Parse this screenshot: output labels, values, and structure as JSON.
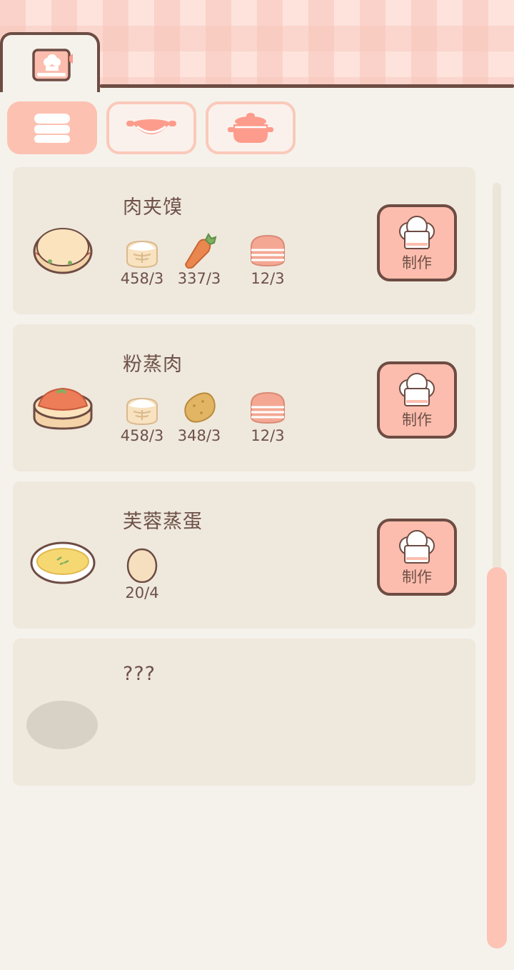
{
  "tabs": {
    "book_tab_icon": "chef-recipe-book-icon",
    "categories": [
      {
        "icon": "steamer-icon",
        "active": true
      },
      {
        "icon": "wok-icon",
        "active": false
      },
      {
        "icon": "pot-icon",
        "active": false
      }
    ]
  },
  "recipes": [
    {
      "name": "肉夹馍",
      "dish_icon": "roujiamo-icon",
      "ingredients": [
        {
          "icon": "flour-icon",
          "count": "458/3"
        },
        {
          "icon": "carrot-icon",
          "count": "337/3"
        },
        {
          "icon": "bacon-icon",
          "count": "12/3"
        }
      ],
      "make_label": "制作"
    },
    {
      "name": "粉蒸肉",
      "dish_icon": "steamed-pork-icon",
      "ingredients": [
        {
          "icon": "flour-icon",
          "count": "458/3"
        },
        {
          "icon": "potato-icon",
          "count": "348/3"
        },
        {
          "icon": "bacon-icon",
          "count": "12/3"
        }
      ],
      "make_label": "制作"
    },
    {
      "name": "芙蓉蒸蛋",
      "dish_icon": "steamed-egg-icon",
      "ingredients": [
        {
          "icon": "egg-icon",
          "count": "20/4"
        }
      ],
      "make_label": "制作"
    },
    {
      "name": "???",
      "dish_icon": "locked-dish-silhouette",
      "ingredients": []
    }
  ],
  "colors": {
    "accent": "#fdc1b1",
    "outline": "#6d4c43",
    "card": "#efe8dd",
    "background": "#f5f2ec"
  }
}
